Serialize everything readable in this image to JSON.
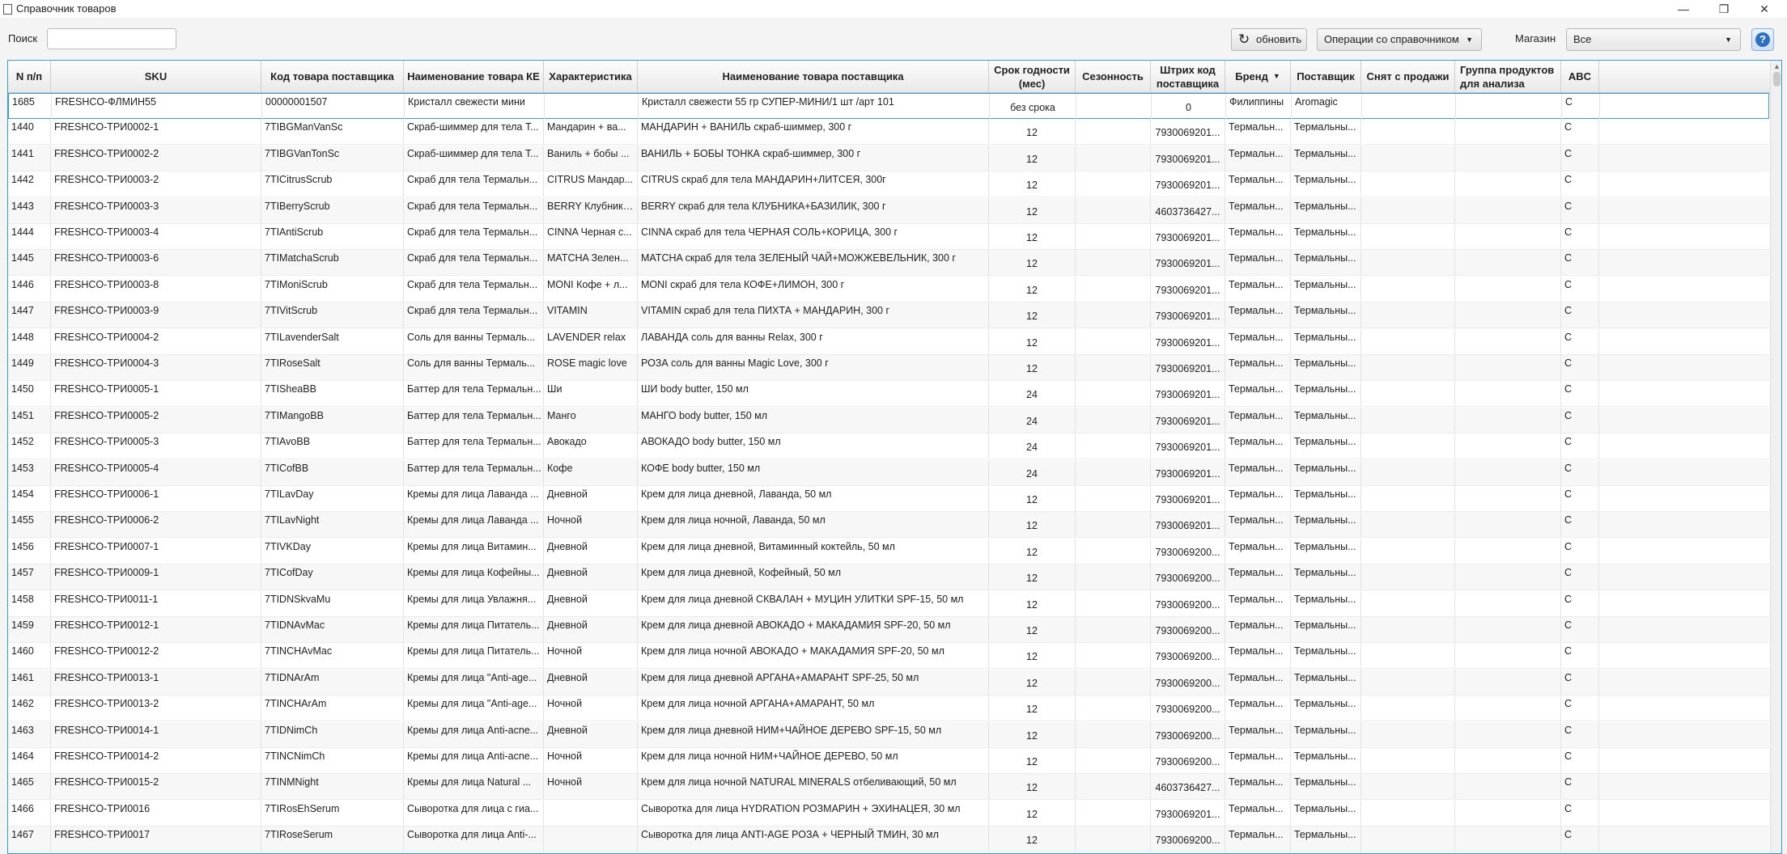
{
  "window": {
    "title": "Справочник товаров",
    "controls": {
      "minimize": "—",
      "maximize": "❐",
      "close": "✕"
    }
  },
  "toolbar": {
    "search_label": "Поиск",
    "search_value": "",
    "refresh_label": "обновить",
    "operations_label": "Операции со справочником",
    "store_label": "Магазин",
    "store_value": "Все",
    "help_label": "?"
  },
  "icons": {
    "refresh": "refresh-icon",
    "dropdown": "chevron-down-icon",
    "help": "help-icon",
    "sort": "sort-desc-icon"
  },
  "colors": {
    "accent": "#3a9ad9",
    "help": "#2f6fc2"
  },
  "table": {
    "columns": [
      "N п/п",
      "SKU",
      "Код товара поставщика",
      "Наименование товара КЕ",
      "Характеристика",
      "Наименование товара поставщика",
      "Срок годности (мес)",
      "Сезонность",
      "Штрих код поставщика",
      "Бренд",
      "Поставщик",
      "Снят с продажи",
      "Группа продуктов для анализа",
      "ABC"
    ],
    "sorted_column": "Бренд",
    "rows": [
      [
        "1685",
        "FRESHCO-ФЛМИН55",
        "00000001507",
        "Кристалл свежести мини",
        "",
        "Кристалл свежести 55 гр СУПЕР-МИНИ/1 шт /арт 101",
        "без срока",
        "",
        "0",
        "Филиппины",
        "Aromagic",
        "",
        "",
        "C"
      ],
      [
        "1440",
        "FRESHCO-ТРИ0002-1",
        "7TIBGManVanSc",
        "Скраб-шиммер для тела Т...",
        "Мандарин + ва...",
        "МАНДАРИН + ВАНИЛЬ скраб-шиммер, 300 г",
        "12",
        "",
        "7930069201...",
        "Термальн...",
        "Термальны...",
        "",
        "",
        "C"
      ],
      [
        "1441",
        "FRESHCO-ТРИ0002-2",
        "7TIBGVanTonSc",
        "Скраб-шиммер для тела Т...",
        "Ваниль + бобы ...",
        "ВАНИЛЬ + БОБЫ ТОНКА скраб-шиммер, 300 г",
        "12",
        "",
        "7930069201...",
        "Термальн...",
        "Термальны...",
        "",
        "",
        "C"
      ],
      [
        "1442",
        "FRESHCO-ТРИ0003-2",
        "7TICitrusScrub",
        "Скраб для тела Термальн...",
        "CITRUS Мандар...",
        "CITRUS скраб для тела МАНДАРИН+ЛИТСЕЯ, 300г",
        "12",
        "",
        "7930069201...",
        "Термальн...",
        "Термальны...",
        "",
        "",
        "C"
      ],
      [
        "1443",
        "FRESHCO-ТРИ0003-3",
        "7TIBerryScrub",
        "Скраб для тела Термальн...",
        "BERRY Клубника...",
        "BERRY скраб для тела КЛУБНИКА+БАЗИЛИК, 300 г",
        "12",
        "",
        "4603736427...",
        "Термальн...",
        "Термальны...",
        "",
        "",
        "C"
      ],
      [
        "1444",
        "FRESHCO-ТРИ0003-4",
        "7TIAntiScrub",
        "Скраб для тела Термальн...",
        "CINNA Черная с...",
        "CINNA скраб для тела ЧЕРНАЯ СОЛЬ+КОРИЦА, 300 г",
        "12",
        "",
        "7930069201...",
        "Термальн...",
        "Термальны...",
        "",
        "",
        "C"
      ],
      [
        "1445",
        "FRESHCO-ТРИ0003-6",
        "7TIMatchaScrub",
        "Скраб для тела Термальн...",
        "MATCHA Зелен...",
        "MATCHA скраб для тела ЗЕЛЕНЫЙ ЧАЙ+МОЖЖЕВЕЛЬНИК, 300 г",
        "12",
        "",
        "7930069201...",
        "Термальн...",
        "Термальны...",
        "",
        "",
        "C"
      ],
      [
        "1446",
        "FRESHCO-ТРИ0003-8",
        "7TIMoniScrub",
        "Скраб для тела Термальн...",
        "MONI Кофе + л...",
        "MONI скраб для тела КОФЕ+ЛИМОН, 300 г",
        "12",
        "",
        "7930069201...",
        "Термальн...",
        "Термальны...",
        "",
        "",
        "C"
      ],
      [
        "1447",
        "FRESHCO-ТРИ0003-9",
        "7TIVitScrub",
        "Скраб для тела Термальн...",
        "VITAMIN",
        "VITAMIN скраб для тела ПИХТА + МАНДАРИН, 300 г",
        "12",
        "",
        "7930069201...",
        "Термальн...",
        "Термальны...",
        "",
        "",
        "C"
      ],
      [
        "1448",
        "FRESHCO-ТРИ0004-2",
        "7TILavenderSalt",
        "Соль для ванны Термаль...",
        "LAVENDER relax",
        "ЛАВАНДА соль для ванны Relax, 300 г",
        "12",
        "",
        "7930069201...",
        "Термальн...",
        "Термальны...",
        "",
        "",
        "C"
      ],
      [
        "1449",
        "FRESHCO-ТРИ0004-3",
        "7TIRoseSalt",
        "Соль для ванны Термаль...",
        "ROSE magic love",
        "РОЗА соль для ванны Magic Love, 300 г",
        "12",
        "",
        "7930069201...",
        "Термальн...",
        "Термальны...",
        "",
        "",
        "C"
      ],
      [
        "1450",
        "FRESHCO-ТРИ0005-1",
        "7TISheaBB",
        "Баттер для тела Термальн...",
        "Ши",
        "ШИ body butter, 150 мл",
        "24",
        "",
        "7930069201...",
        "Термальн...",
        "Термальны...",
        "",
        "",
        "C"
      ],
      [
        "1451",
        "FRESHCO-ТРИ0005-2",
        "7TIMangoBB",
        "Баттер для тела Термальн...",
        "Манго",
        "МАНГО body butter, 150 мл",
        "24",
        "",
        "7930069201...",
        "Термальн...",
        "Термальны...",
        "",
        "",
        "C"
      ],
      [
        "1452",
        "FRESHCO-ТРИ0005-3",
        "7TIAvoBB",
        "Баттер для тела Термальн...",
        "Авокадо",
        "АВОКАДО body butter, 150 мл",
        "24",
        "",
        "7930069201...",
        "Термальн...",
        "Термальны...",
        "",
        "",
        "C"
      ],
      [
        "1453",
        "FRESHCO-ТРИ0005-4",
        "7TICofBB",
        "Баттер для тела Термальн...",
        "Кофе",
        "КОФЕ body butter, 150 мл",
        "24",
        "",
        "7930069201...",
        "Термальн...",
        "Термальны...",
        "",
        "",
        "C"
      ],
      [
        "1454",
        "FRESHCO-ТРИ0006-1",
        "7TILavDay",
        "Кремы для лица Лаванда ...",
        "Дневной",
        "Крем для лица дневной, Лаванда, 50 мл",
        "12",
        "",
        "7930069201...",
        "Термальн...",
        "Термальны...",
        "",
        "",
        "C"
      ],
      [
        "1455",
        "FRESHCO-ТРИ0006-2",
        "7TILavNight",
        "Кремы для лица Лаванда ...",
        "Ночной",
        "Крем для лица ночной, Лаванда, 50 мл",
        "12",
        "",
        "7930069201...",
        "Термальн...",
        "Термальны...",
        "",
        "",
        "C"
      ],
      [
        "1456",
        "FRESHCO-ТРИ0007-1",
        "7TIVKDay",
        "Кремы для лица Витамин...",
        "Дневной",
        "Крем для лица дневной, Витаминный коктейль, 50 мл",
        "12",
        "",
        "7930069200...",
        "Термальн...",
        "Термальны...",
        "",
        "",
        "C"
      ],
      [
        "1457",
        "FRESHCO-ТРИ0009-1",
        "7TICofDay",
        "Кремы для лица Кофейны...",
        "Дневной",
        "Крем для лица дневной, Кофейный, 50 мл",
        "12",
        "",
        "7930069200...",
        "Термальн...",
        "Термальны...",
        "",
        "",
        "C"
      ],
      [
        "1458",
        "FRESHCO-ТРИ0011-1",
        "7TIDNSkvaMu",
        "Кремы для лица Увлажня...",
        "Дневной",
        "Крем для лица дневной СКВАЛАН + МУЦИН УЛИТКИ SPF-15, 50 мл",
        "12",
        "",
        "7930069200...",
        "Термальн...",
        "Термальны...",
        "",
        "",
        "C"
      ],
      [
        "1459",
        "FRESHCO-ТРИ0012-1",
        "7TIDNAvMac",
        "Кремы для лица Питатель...",
        "Дневной",
        "Крем для лица дневной АВОКАДО + МАКАДАМИЯ SPF-20, 50 мл",
        "12",
        "",
        "7930069200...",
        "Термальн...",
        "Термальны...",
        "",
        "",
        "C"
      ],
      [
        "1460",
        "FRESHCO-ТРИ0012-2",
        "7TINCHAvMac",
        "Кремы для лица Питатель...",
        "Ночной",
        "Крем для лица ночной АВОКАДО + МАКАДАМИЯ SPF-20, 50 мл",
        "12",
        "",
        "7930069200...",
        "Термальн...",
        "Термальны...",
        "",
        "",
        "C"
      ],
      [
        "1461",
        "FRESHCO-ТРИ0013-1",
        "7TIDNArAm",
        "Кремы для лица \"Anti-age...",
        "Дневной",
        "Крем для лица дневной АРГАНА+АМАРАНТ SPF-25, 50 мл",
        "12",
        "",
        "7930069200...",
        "Термальн...",
        "Термальны...",
        "",
        "",
        "C"
      ],
      [
        "1462",
        "FRESHCO-ТРИ0013-2",
        "7TINCHArAm",
        "Кремы для лица \"Anti-age...",
        "Ночной",
        "Крем для лица ночной АРГАНА+АМАРАНТ, 50 мл",
        "12",
        "",
        "7930069200...",
        "Термальн...",
        "Термальны...",
        "",
        "",
        "C"
      ],
      [
        "1463",
        "FRESHCO-ТРИ0014-1",
        "7TIDNimCh",
        "Кремы для лица Anti-acne...",
        "Дневной",
        "Крем для лица дневной НИМ+ЧАЙНОЕ ДЕРЕВО SPF-15, 50 мл",
        "12",
        "",
        "7930069200...",
        "Термальн...",
        "Термальны...",
        "",
        "",
        "C"
      ],
      [
        "1464",
        "FRESHCO-ТРИ0014-2",
        "7TINCNimCh",
        "Кремы для лица Anti-acne...",
        "Ночной",
        "Крем для лица ночной НИМ+ЧАЙНОЕ ДЕРЕВО, 50 мл",
        "12",
        "",
        "7930069200...",
        "Термальн...",
        "Термальны...",
        "",
        "",
        "C"
      ],
      [
        "1465",
        "FRESHCO-ТРИ0015-2",
        "7TINMNight",
        "Кремы для лица Natural ...",
        "Ночной",
        "Крем для лица ночной NATURAL MINERALS отбеливающий, 50 мл",
        "12",
        "",
        "4603736427...",
        "Термальн...",
        "Термальны...",
        "",
        "",
        "C"
      ],
      [
        "1466",
        "FRESHCO-ТРИ0016",
        "7TIRosEhSerum",
        "Сыворотка для лица с гиа...",
        "",
        "Сыворотка для лица HYDRATION РОЗМАРИН + ЭХИНАЦЕЯ, 30 мл",
        "12",
        "",
        "7930069201...",
        "Термальн...",
        "Термальны...",
        "",
        "",
        "C"
      ],
      [
        "1467",
        "FRESHCO-ТРИ0017",
        "7TIRoseSerum",
        "Сыворотка для лица Anti-...",
        "",
        "Сыворотка для лица ANTI-AGE РОЗА + ЧЕРНЫЙ ТМИН, 30 мл",
        "12",
        "",
        "7930069200...",
        "Термальн...",
        "Термальны...",
        "",
        "",
        "C"
      ]
    ]
  }
}
